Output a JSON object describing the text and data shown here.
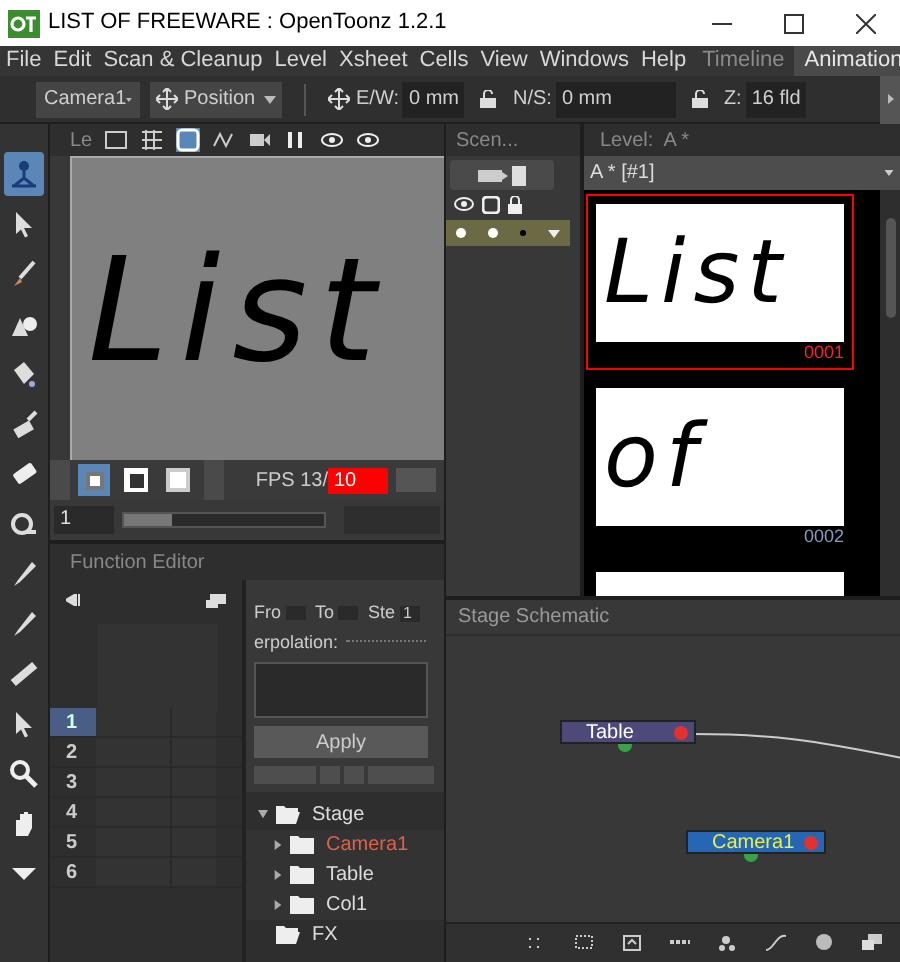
{
  "window": {
    "title": "LIST OF FREEWARE : OpenToonz 1.2.1"
  },
  "menu": [
    "File",
    "Edit",
    "Scan & Cleanup",
    "Level",
    "Xsheet",
    "Cells",
    "View",
    "Windows",
    "Help"
  ],
  "rooms": [
    {
      "label": "Timeline",
      "selected": false
    },
    {
      "label": "Animation",
      "selected": true
    }
  ],
  "edit_toolbar": {
    "object": "Camera1",
    "mode": "Position",
    "ew_label": "E/W:",
    "ew_value": "0 mm",
    "ns_label": "N/S:",
    "ns_value": "0 mm",
    "z_label": "Z:",
    "z_value": "16 fld"
  },
  "tools": [
    {
      "kind": "animate",
      "selected": true
    },
    {
      "kind": "select",
      "selected": false
    },
    {
      "kind": "brush",
      "selected": false
    },
    {
      "kind": "geometric",
      "selected": false
    },
    {
      "kind": "fill",
      "selected": false
    },
    {
      "kind": "paint",
      "selected": false
    },
    {
      "kind": "eraser",
      "selected": false
    },
    {
      "kind": "tape",
      "selected": false
    },
    {
      "kind": "picker",
      "selected": false
    },
    {
      "kind": "picker",
      "selected": false
    },
    {
      "kind": "ruler",
      "selected": false
    },
    {
      "kind": "select",
      "selected": false
    },
    {
      "kind": "zoom",
      "selected": false
    },
    {
      "kind": "hand",
      "selected": false
    },
    {
      "kind": "more",
      "selected": false
    }
  ],
  "viewer": {
    "title": "Le",
    "drawing_text": "List",
    "fps_label": "FPS 13/",
    "fps_value": "10",
    "frame": "1",
    "slider": {
      "level": 0.24
    }
  },
  "scene_cast": {
    "title": "Scen..."
  },
  "level_strip": {
    "title": "Level:  A *",
    "level_name": "A * [#1]",
    "frames": [
      {
        "text": "List",
        "number": "0001",
        "selected": true
      },
      {
        "text": "of",
        "number": "0002",
        "selected": false
      },
      {
        "selected": false
      }
    ]
  },
  "function_editor": {
    "title": "Function Editor",
    "from_label": "Fro",
    "to_label": "To",
    "step_label": "Ste",
    "step_value": "1",
    "interpolation_label": "erpolation:",
    "apply": "Apply",
    "rows": [
      {
        "label": "1",
        "selected": true
      },
      {
        "label": "2",
        "selected": false
      },
      {
        "label": "3",
        "selected": false
      },
      {
        "label": "4",
        "selected": false
      },
      {
        "label": "5",
        "selected": false
      },
      {
        "label": "6",
        "selected": false
      }
    ],
    "tree": [
      {
        "label": "Stage",
        "expanded": true,
        "current": false,
        "children": [
          {
            "label": "Camera1",
            "expanded": false,
            "current": true
          },
          {
            "label": "Table",
            "expanded": false,
            "current": false
          },
          {
            "label": "Col1",
            "expanded": false,
            "current": false
          }
        ]
      },
      {
        "label": "FX",
        "expanded": true,
        "current": false
      }
    ]
  },
  "stage_schematic": {
    "title": "Stage Schematic",
    "nodes": [
      {
        "label": "Table",
        "kind": "table"
      },
      {
        "label": "Camera1",
        "kind": "camera"
      }
    ]
  }
}
